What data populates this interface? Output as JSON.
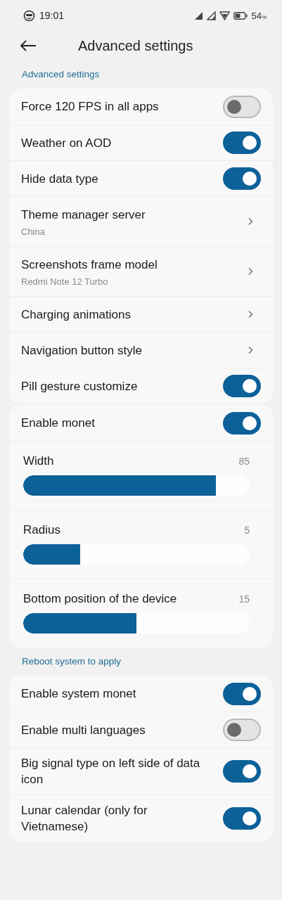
{
  "status_bar": {
    "time": "19:01",
    "battery": "54",
    "battery_unit": "%"
  },
  "header": {
    "title": "Advanced settings"
  },
  "groups": [
    {
      "label": "Advanced settings",
      "items": [
        {
          "kind": "toggle",
          "title": "Force 120 FPS in all apps",
          "on": false
        },
        {
          "kind": "toggle",
          "title": "Weather on AOD",
          "on": true
        },
        {
          "kind": "toggle",
          "title": "Hide data type",
          "on": true
        },
        {
          "kind": "link",
          "title": "Theme manager server",
          "subtitle": "China"
        },
        {
          "kind": "link",
          "title": "Screenshots frame model",
          "subtitle": "Redmi Note 12 Turbo"
        },
        {
          "kind": "link",
          "title": "Charging animations"
        },
        {
          "kind": "link",
          "title": "Navigation button style"
        },
        {
          "kind": "toggle",
          "title": "Pill gesture customize",
          "on": true
        }
      ]
    },
    {
      "items": [
        {
          "kind": "toggle",
          "title": "Enable monet",
          "on": true
        },
        {
          "kind": "slider",
          "title": "Width",
          "reading": "85",
          "level": 0.85
        },
        {
          "kind": "slider",
          "title": "Radius",
          "reading": "5",
          "level": 0.25
        },
        {
          "kind": "slider",
          "title": "Bottom position of the device",
          "reading": "15",
          "level": 0.5
        }
      ]
    },
    {
      "label": "Reboot system to apply",
      "items": [
        {
          "kind": "toggle",
          "title": "Enable system monet",
          "on": true
        },
        {
          "kind": "toggle",
          "title": "Enable multi languages",
          "on": false
        },
        {
          "kind": "toggle",
          "title": "Big signal type on left side of data icon",
          "on": true
        },
        {
          "kind": "toggle",
          "title": "Lunar calendar (only for Vietnamese)",
          "on": true
        }
      ]
    }
  ]
}
